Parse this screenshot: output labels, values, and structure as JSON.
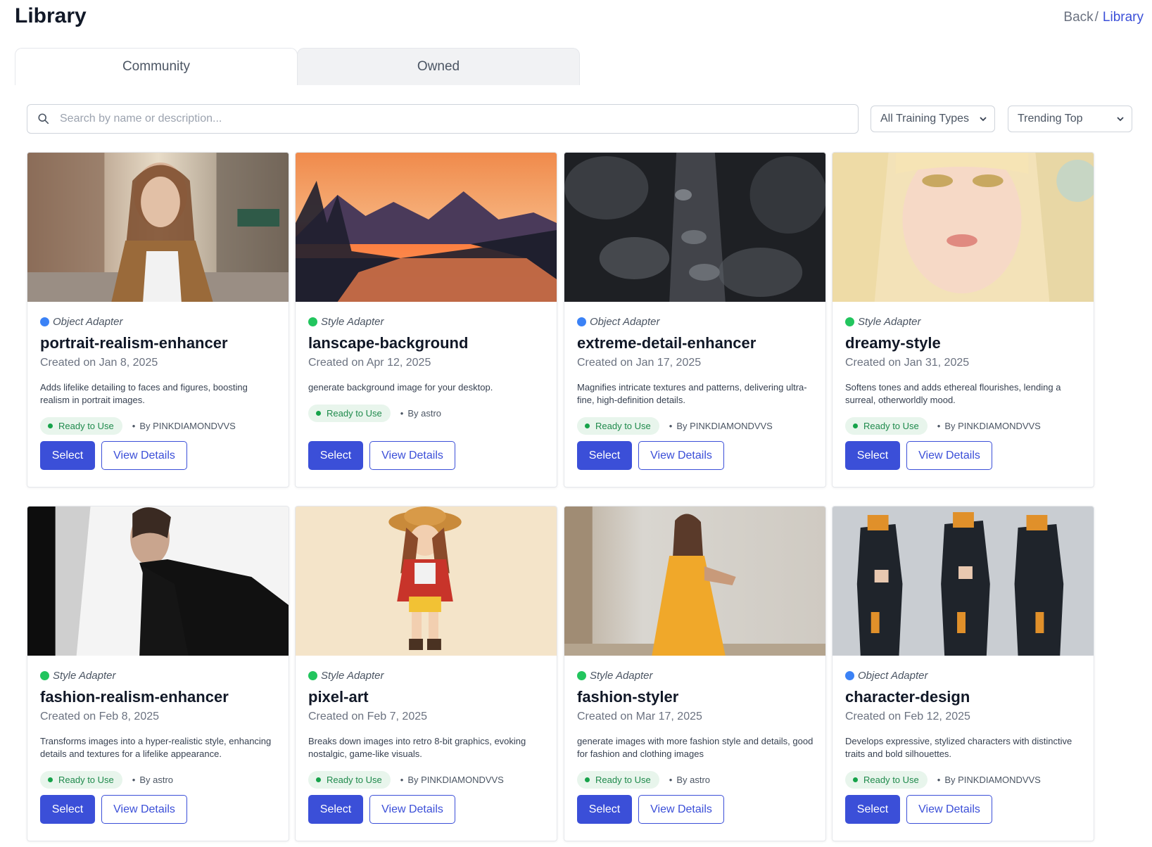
{
  "header": {
    "title": "Library",
    "breadcrumb": {
      "back": "Back",
      "separator": "/",
      "current": "Library"
    }
  },
  "tabs": [
    {
      "label": "Community",
      "active": true
    },
    {
      "label": "Owned",
      "active": false
    }
  ],
  "filters": {
    "search_placeholder": "Search by name or description...",
    "training_type": "All Training Types",
    "sort": "Trending Top"
  },
  "cards": [
    {
      "type": "Object Adapter",
      "name": "portrait-realism-enhancer",
      "created": "Created on Jan 8, 2025",
      "description": "Adds lifelike detailing to faces and figures, boosting realism in portrait images.",
      "status": "Ready to Use",
      "author": "By PINKDIAMONDVVS",
      "select": "Select",
      "view": "View Details"
    },
    {
      "type": "Style Adapter",
      "name": "lanscape-background",
      "created": "Created on Apr 12, 2025",
      "description": "generate background image for your desktop.",
      "status": "Ready to Use",
      "author": "By astro",
      "select": "Select",
      "view": "View Details"
    },
    {
      "type": "Object Adapter",
      "name": "extreme-detail-enhancer",
      "created": "Created on Jan 17, 2025",
      "description": "Magnifies intricate textures and patterns, delivering ultra-fine, high-definition details.",
      "status": "Ready to Use",
      "author": "By PINKDIAMONDVVS",
      "select": "Select",
      "view": "View Details"
    },
    {
      "type": "Style Adapter",
      "name": "dreamy-style",
      "created": "Created on Jan 31, 2025",
      "description": "Softens tones and adds ethereal flourishes, lending a surreal, otherworldly mood.",
      "status": "Ready to Use",
      "author": "By PINKDIAMONDVVS",
      "select": "Select",
      "view": "View Details"
    },
    {
      "type": "Style Adapter",
      "name": "fashion-realism-enhancer",
      "created": "Created on Feb 8, 2025",
      "description": "Transforms images into a hyper-realistic style, enhancing details and textures for a lifelike appearance.",
      "status": "Ready to Use",
      "author": "By astro",
      "select": "Select",
      "view": "View Details"
    },
    {
      "type": "Style Adapter",
      "name": "pixel-art",
      "created": "Created on Feb 7, 2025",
      "description": "Breaks down images into retro 8-bit graphics, evoking nostalgic, game-like visuals.",
      "status": "Ready to Use",
      "author": "By PINKDIAMONDVVS",
      "select": "Select",
      "view": "View Details"
    },
    {
      "type": "Style Adapter",
      "name": "fashion-styler",
      "created": "Created on Mar 17, 2025",
      "description": "generate images with more fashion style and details, good for fashion and clothing images",
      "status": "Ready to Use",
      "author": "By astro",
      "select": "Select",
      "view": "View Details"
    },
    {
      "type": "Object Adapter",
      "name": "character-design",
      "created": "Created on Feb 12, 2025",
      "description": "Develops expressive, stylized characters with distinctive traits and bold silhouettes.",
      "status": "Ready to Use",
      "author": "By PINKDIAMONDVVS",
      "select": "Select",
      "view": "View Details"
    }
  ],
  "colors": {
    "accent": "#3b4fd8",
    "object_dot": "#3b82f6",
    "style_dot": "#22c55e",
    "ready_bg": "#e8f5ec",
    "ready_text": "#1f8a4c"
  }
}
